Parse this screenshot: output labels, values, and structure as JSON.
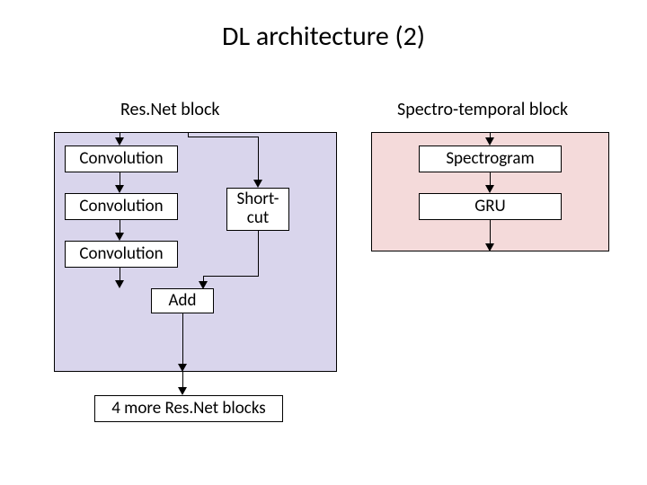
{
  "title": "DL architecture (2)",
  "left": {
    "label": "Res.Net block",
    "boxes": {
      "conv1": "Convolution",
      "conv2": "Convolution",
      "conv3": "Convolution",
      "shortcut": "Short-\ncut",
      "add": "Add"
    },
    "footer": "4 more Res.Net blocks"
  },
  "right": {
    "label": "Spectro-temporal block",
    "boxes": {
      "spectrogram": "Spectrogram",
      "gru": "GRU"
    }
  }
}
